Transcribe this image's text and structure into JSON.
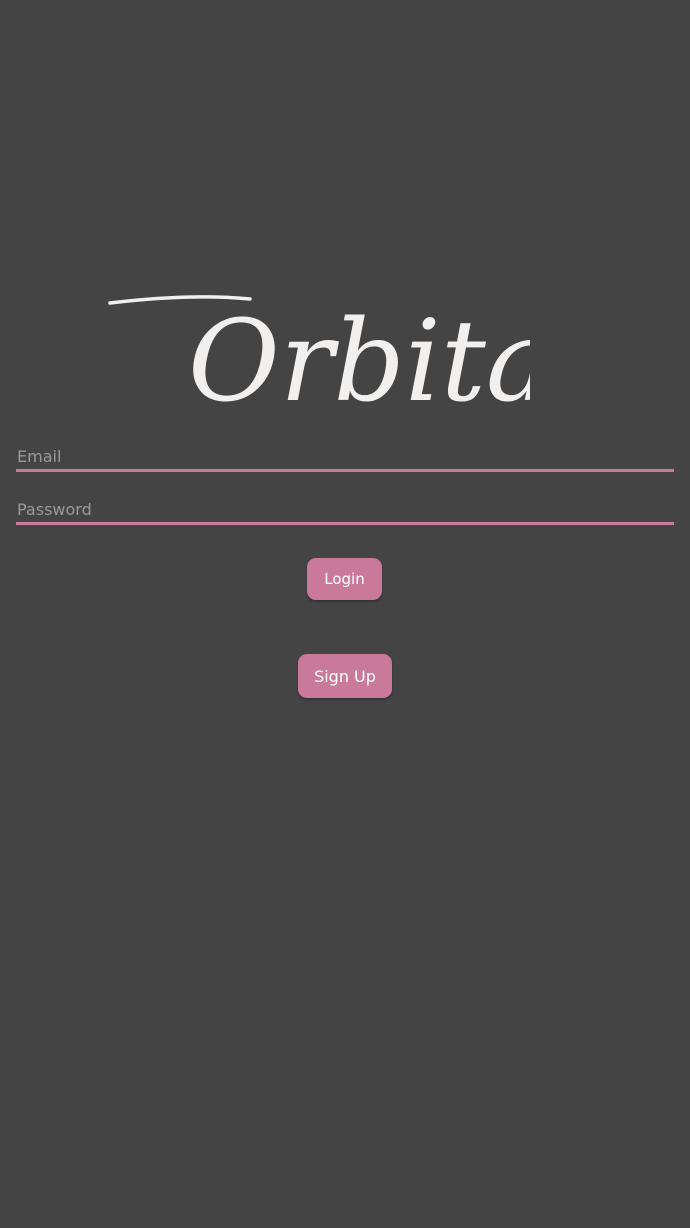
{
  "app": {
    "logo_text": "Orbital"
  },
  "form": {
    "email_placeholder": "Email",
    "email_value": "",
    "password_placeholder": "Password",
    "password_value": ""
  },
  "actions": {
    "login_label": "Login",
    "signup_label": "Sign Up"
  },
  "colors": {
    "background": "#444444",
    "accent": "#c97a9a",
    "logo": "#f2f0ee",
    "placeholder": "#9a9a9a"
  }
}
